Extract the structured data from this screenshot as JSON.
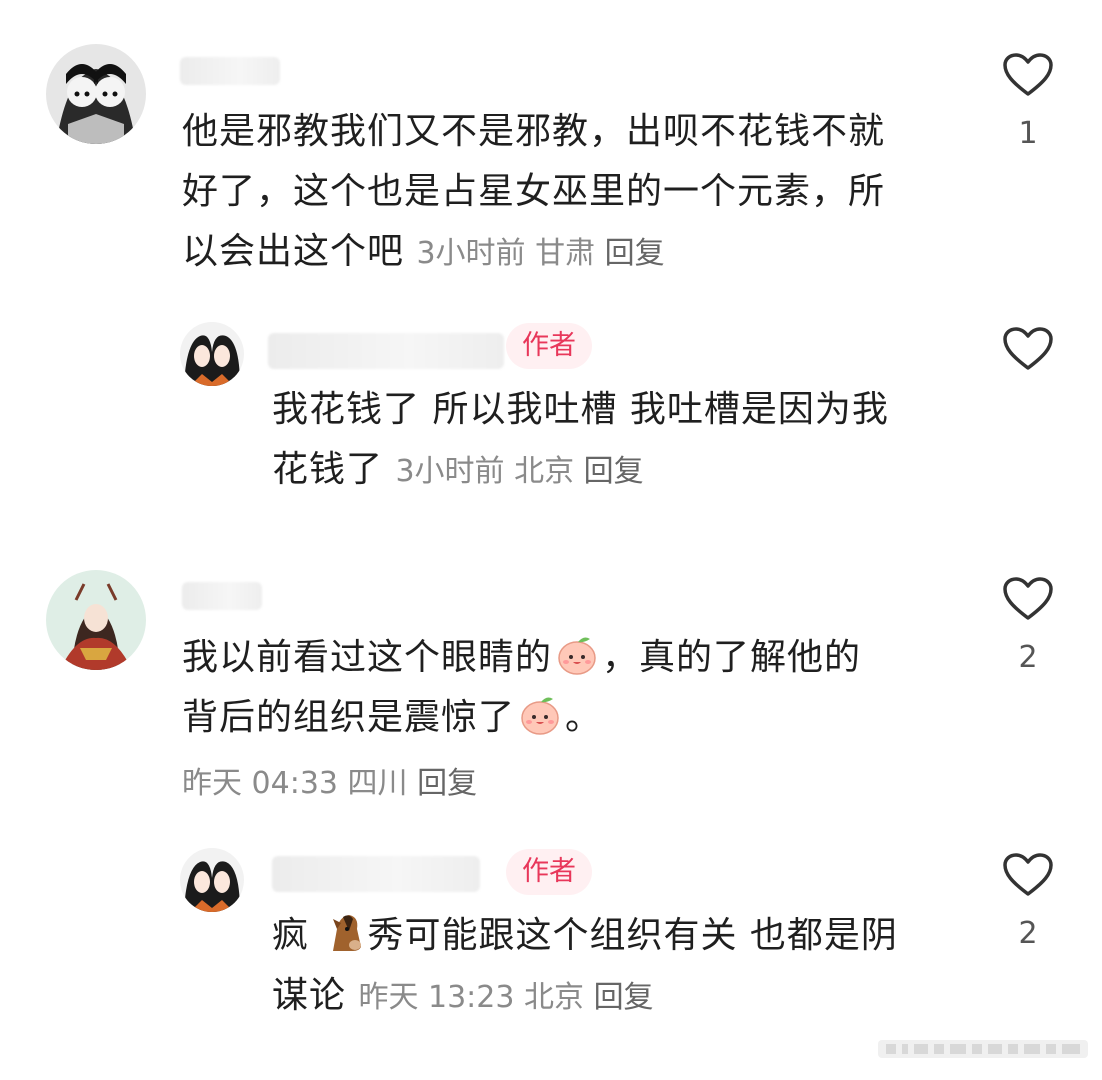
{
  "comments": [
    {
      "text": "他是邪教我们又不是邪教，出呗不花钱不就好了，这个也是占星女巫里的一个元素，所以会出这个吧",
      "line1": "他是邪教我们又不是邪教，出呗不花钱不就",
      "line2": "好了，这个也是占星女巫里的一个元素，所",
      "line3": "以会出这个吧",
      "time": "3小时前",
      "location": "甘肃",
      "reply": "回复",
      "likes": "1"
    },
    {
      "author_badge": "作者",
      "line1": "我花钱了 所以我吐槽 我吐槽是因为我",
      "line2": "花钱了",
      "time": "3小时前",
      "location": "北京",
      "reply": "回复",
      "likes": ""
    },
    {
      "line1_a": "我以前看过这个眼睛的",
      "line1_b": "，真的了解他的",
      "line2_a": "背后的组织是震惊了",
      "line2_b": "。",
      "time": "昨天 04:33",
      "location": "四川",
      "reply": "回复",
      "likes": "2"
    },
    {
      "author_badge": "作者",
      "line1_a": "疯",
      "line1_b": "秀可能跟这个组织有关 也都是阴",
      "line2": "谋论",
      "time": "昨天 13:23",
      "location": "北京",
      "reply": "回复",
      "likes": "2"
    }
  ],
  "icons": {
    "like": "heart-outline-icon",
    "peach": "peach-face-emoji",
    "horse": "horse-face-emoji"
  },
  "colors": {
    "badge_text": "#e8375a",
    "badge_bg": "#fff0f2",
    "meta": "#8a8a8a"
  }
}
